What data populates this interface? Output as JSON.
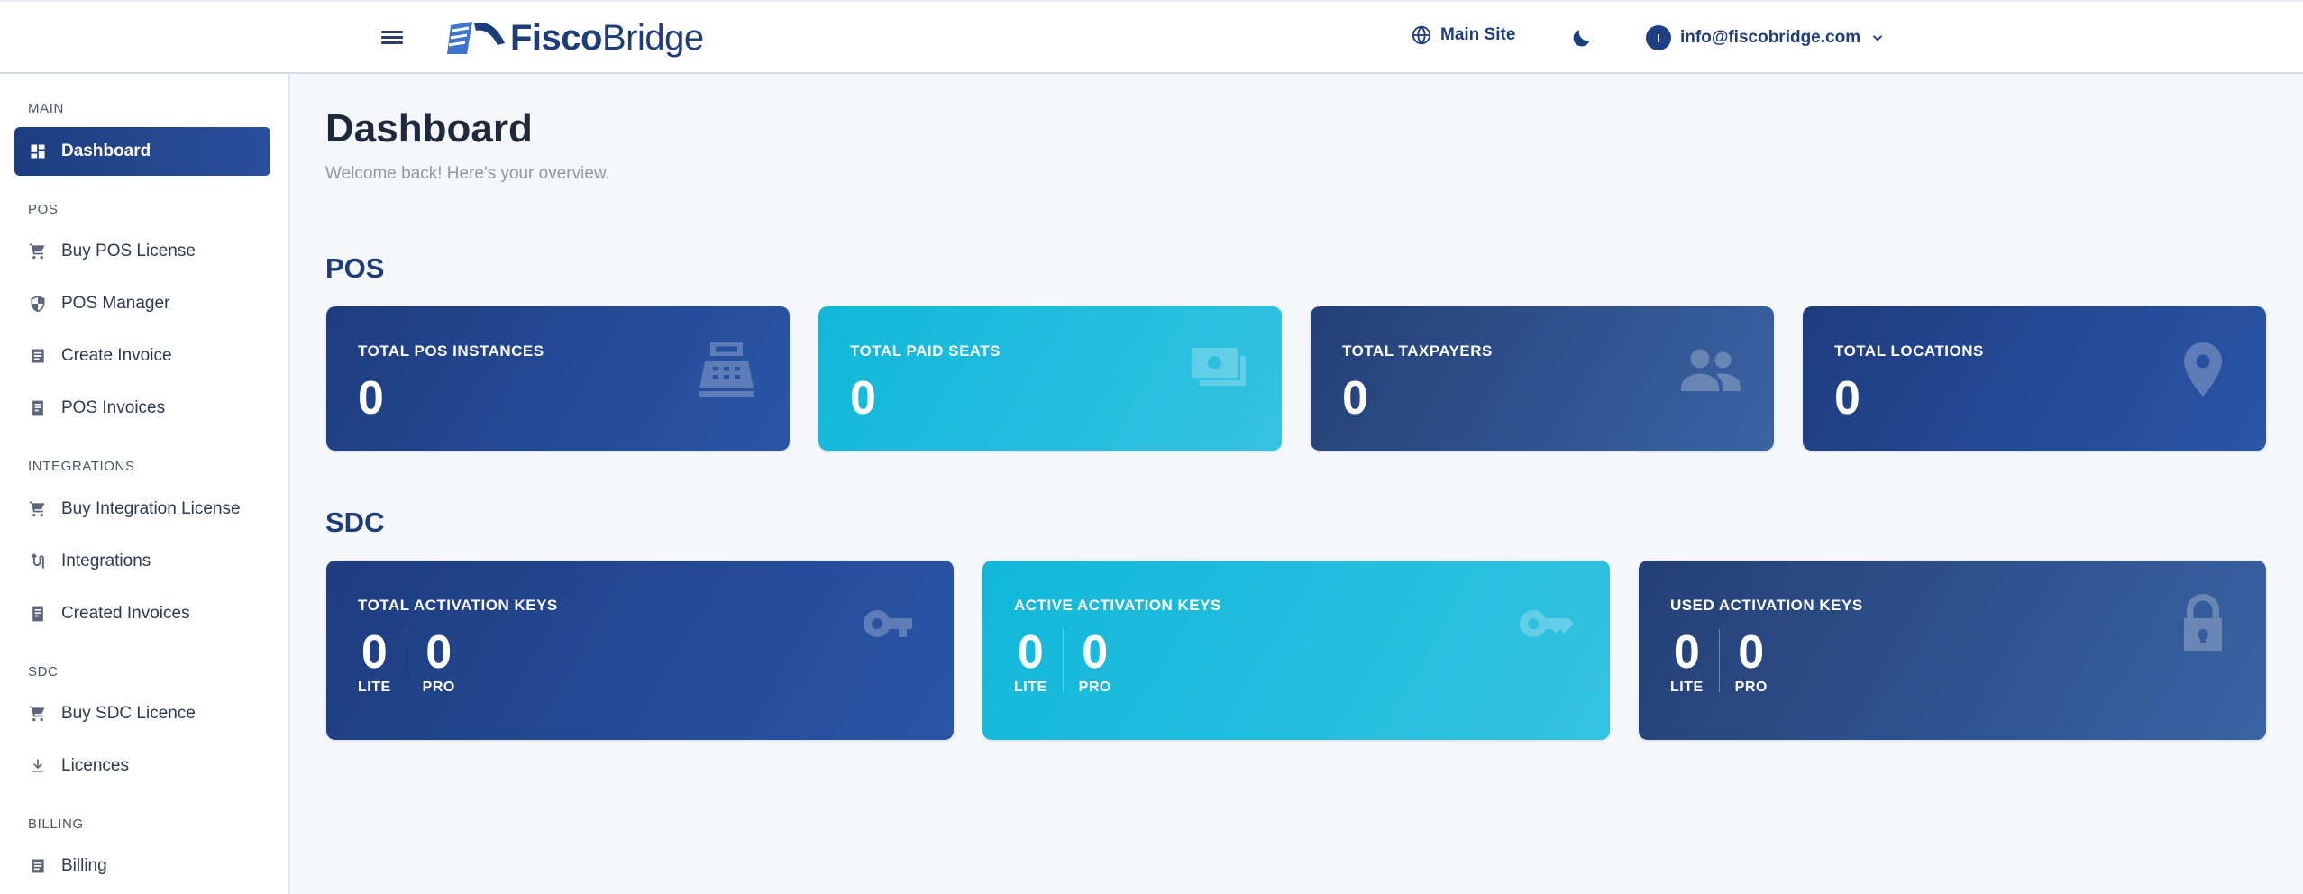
{
  "header": {
    "brand_bold": "Fisco",
    "brand_regular": "Bridge",
    "main_site_label": "Main Site",
    "account_initial": "I",
    "account_email": "info@fiscobridge.com"
  },
  "sidebar": {
    "sections": {
      "main": "MAIN",
      "pos": "POS",
      "integrations": "INTEGRATIONS",
      "sdc": "SDC",
      "billing": "BILLING"
    },
    "items": {
      "dashboard": "Dashboard",
      "buy_pos_license": "Buy POS License",
      "pos_manager": "POS Manager",
      "create_invoice": "Create Invoice",
      "pos_invoices": "POS Invoices",
      "buy_integration_license": "Buy Integration License",
      "integrations": "Integrations",
      "created_invoices": "Created Invoices",
      "buy_sdc_licence": "Buy SDC Licence",
      "licences": "Licences",
      "billing": "Billing"
    }
  },
  "main": {
    "title": "Dashboard",
    "subtitle": "Welcome back! Here's your overview.",
    "pos_heading": "POS",
    "sdc_heading": "SDC",
    "pos_cards": {
      "instances": {
        "label": "TOTAL POS INSTANCES",
        "value": "0"
      },
      "paid_seats": {
        "label": "TOTAL PAID SEATS",
        "value": "0"
      },
      "taxpayers": {
        "label": "TOTAL TAXPAYERS",
        "value": "0"
      },
      "locations": {
        "label": "TOTAL LOCATIONS",
        "value": "0"
      }
    },
    "sdc_cards": {
      "total": {
        "label": "TOTAL ACTIVATION KEYS",
        "lite": "0",
        "pro": "0"
      },
      "active": {
        "label": "ACTIVE ACTIVATION KEYS",
        "lite": "0",
        "pro": "0"
      },
      "used": {
        "label": "USED ACTIVATION KEYS",
        "lite": "0",
        "pro": "0"
      }
    },
    "lite_label": "LITE",
    "pro_label": "PRO"
  },
  "colors": {
    "brand": "#1c3d7a",
    "card_blue": "#2a56a8",
    "card_cyan": "#11b8d9",
    "card_slate": "#3a64a3"
  }
}
